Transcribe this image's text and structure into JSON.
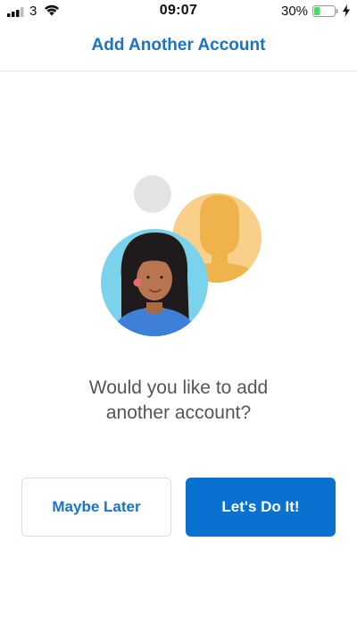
{
  "status_bar": {
    "carrier": "3",
    "time": "09:07",
    "battery_percent": "30%",
    "signal_icon": "cellular-signal-icon",
    "wifi_icon": "wifi-icon",
    "battery_icon": "battery-icon",
    "charging_icon": "charging-bolt-icon",
    "battery_level": 0.3
  },
  "header": {
    "title": "Add Another Account"
  },
  "illustration": {
    "name": "account-avatars-illustration"
  },
  "prompt": {
    "line1": "Would you like to add",
    "line2": "another account?"
  },
  "buttons": {
    "later_label": "Maybe Later",
    "doit_label": "Let's Do It!"
  },
  "colors": {
    "accent": "#1a73c9",
    "primary_button": "#0a71d1",
    "avatar_orange": "#f6c46a",
    "avatar_blue": "#7ad3ea",
    "battery_green": "#4cd964"
  }
}
